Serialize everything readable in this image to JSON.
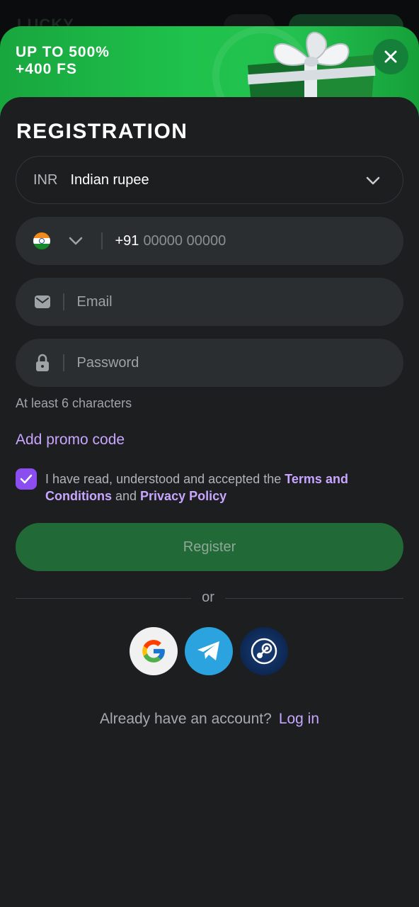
{
  "header": {
    "logo_text": "LUCKY"
  },
  "banner": {
    "line1": "UP TO 500%",
    "line2": "+400 FS"
  },
  "form": {
    "title": "REGISTRATION",
    "currency": {
      "code": "INR",
      "name": "Indian rupee"
    },
    "phone": {
      "country": "India",
      "prefix": "+91",
      "placeholder": "00000 00000"
    },
    "email": {
      "placeholder": "Email"
    },
    "password": {
      "placeholder": "Password",
      "hint": "At least 6 characters"
    },
    "promo_link": "Add promo code",
    "terms": {
      "checked": true,
      "text_before": "I have read, understood and accepted the ",
      "terms_link": "Terms and Conditions",
      "text_middle": " and ",
      "privacy_link": "Privacy Policy"
    },
    "register_label": "Register",
    "divider_text": "or",
    "social": [
      {
        "name": "google",
        "icon": "google-icon"
      },
      {
        "name": "telegram",
        "icon": "telegram-icon"
      },
      {
        "name": "steam",
        "icon": "steam-icon"
      }
    ],
    "login_prompt": "Already have an account?",
    "login_link": "Log in"
  },
  "colors": {
    "accent_purple": "#c8a6ff",
    "checkbox": "#8b4cf0",
    "register_button": "#216a38",
    "banner_green": "#1fc24c",
    "sheet_bg": "#1c1e20",
    "field_bg": "#2b2e31"
  }
}
